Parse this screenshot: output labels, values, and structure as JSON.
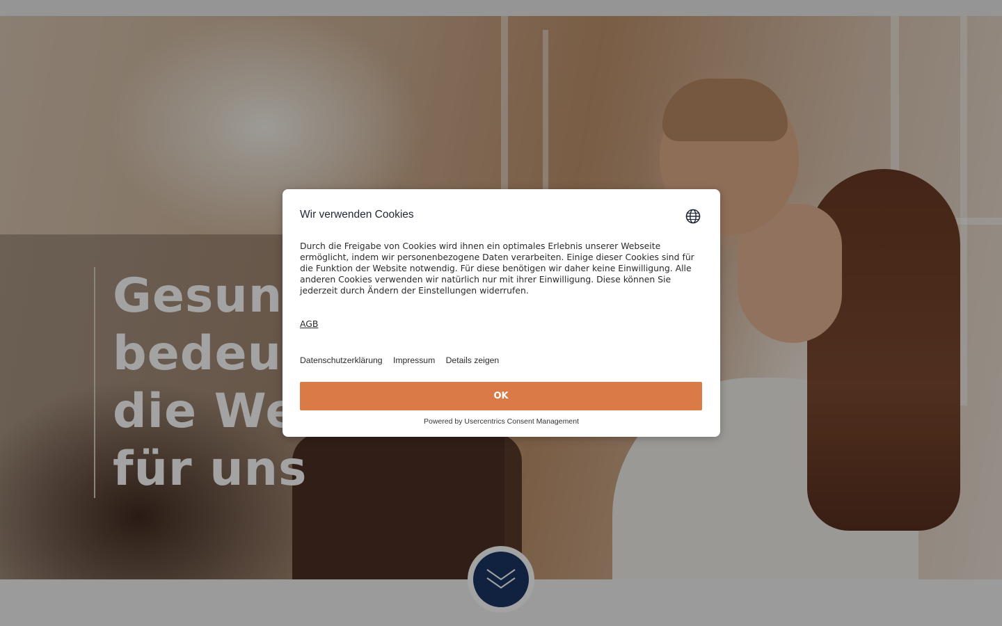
{
  "hero": {
    "heading_lines": [
      "Gesundheit",
      "bedeutet",
      "die Welt",
      "für uns"
    ]
  },
  "cookie_dialog": {
    "title": "Wir verwenden Cookies",
    "language_icon": "globe-icon",
    "body": "Durch die Freigabe von Cookies wird ihnen ein optimales Erlebnis unserer Webseite ermöglicht, indem wir personenbezogene Daten verarbeiten. Einige dieser Cookies sind für die Funktion der Website notwendig. Für diese benötigen wir daher keine Einwilligung. Alle anderen Cookies verwenden wir natürlich nur mit ihrer Einwilligung. Diese können Sie jederzeit durch Ändern der Einstellungen widerrufen.",
    "agb_link": "AGB",
    "links": {
      "privacy": "Datenschutzerklärung",
      "imprint": "Impressum",
      "details": "Details zeigen"
    },
    "ok_label": "OK",
    "powered_by": "Powered by Usercentrics Consent Management"
  },
  "scroll_button": {
    "icon": "double-chevron-down-icon"
  },
  "colors": {
    "accent_orange": "#d97a47",
    "navy": "#1c3564",
    "overlay": "rgba(0,0,0,0.36)"
  }
}
